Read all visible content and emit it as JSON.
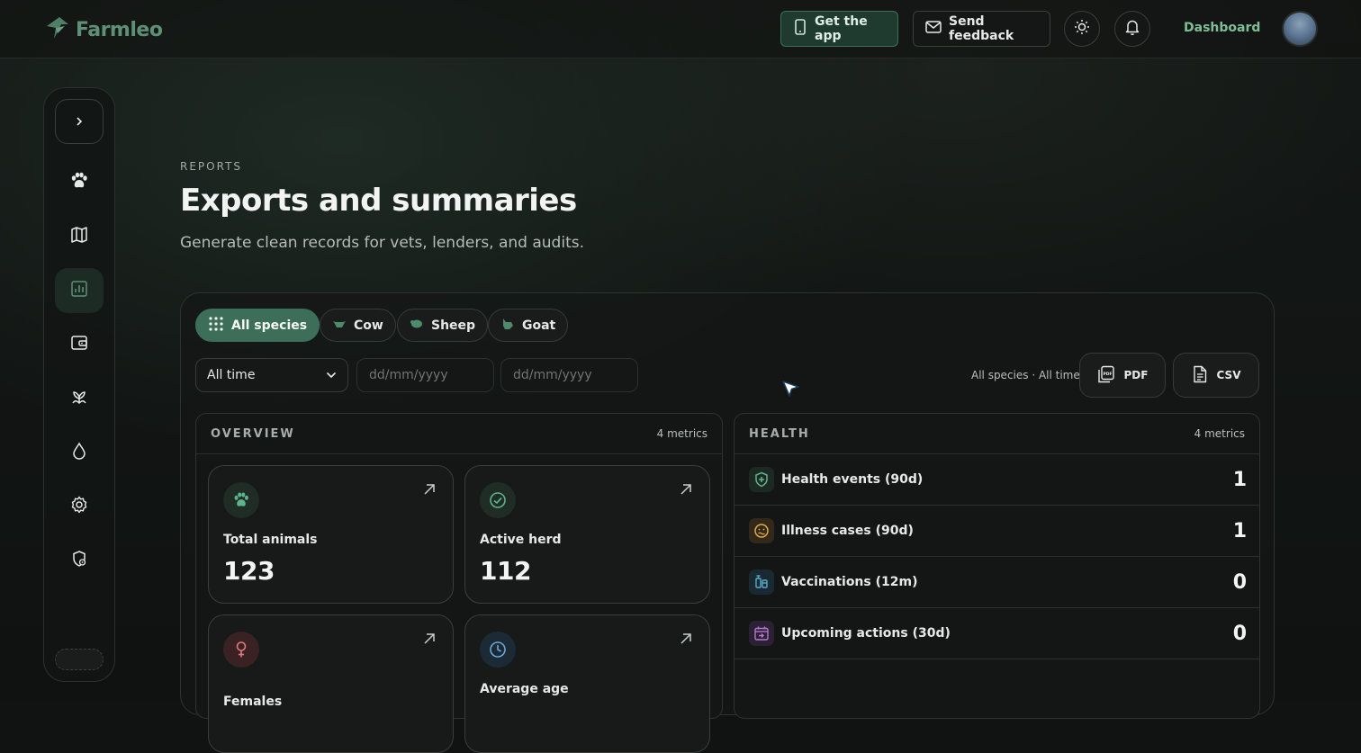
{
  "brand": {
    "name": "Farmleo",
    "accent": "#5f8f77"
  },
  "topbar": {
    "get_app": "Get the app",
    "send_feedback": "Send feedback",
    "dashboard": "Dashboard"
  },
  "sidebar": {
    "items": [
      {
        "icon": "paw-icon"
      },
      {
        "icon": "map-icon"
      },
      {
        "icon": "chart-icon",
        "active": true
      },
      {
        "icon": "wallet-icon"
      },
      {
        "icon": "plant-icon"
      },
      {
        "icon": "drop-icon"
      },
      {
        "icon": "gear-icon"
      },
      {
        "icon": "shield-icon"
      }
    ]
  },
  "header": {
    "eyebrow": "REPORTS",
    "title": "Exports and summaries",
    "subtitle": "Generate clean records for vets, lenders, and audits."
  },
  "filters": {
    "species": [
      "All species",
      "Cow",
      "Sheep",
      "Goat"
    ],
    "active_species": "All species",
    "period": "All time",
    "date_from_placeholder": "dd/mm/yyyy",
    "date_to_placeholder": "dd/mm/yyyy",
    "summary": "All species · All time"
  },
  "exports": {
    "pdf": "PDF",
    "csv": "CSV"
  },
  "overview": {
    "title": "OVERVIEW",
    "count": "4 metrics",
    "metrics": [
      {
        "label": "Total animals",
        "value": "123"
      },
      {
        "label": "Active herd",
        "value": "112"
      },
      {
        "label": "Females",
        "value": ""
      },
      {
        "label": "Average age",
        "value": ""
      }
    ]
  },
  "health": {
    "title": "HEALTH",
    "count": "4 metrics",
    "rows": [
      {
        "label": "Health events (90d)",
        "value": "1",
        "color": "#5fb38b"
      },
      {
        "label": "Illness cases (90d)",
        "value": "1",
        "color": "#e0a94a"
      },
      {
        "label": "Vaccinations (12m)",
        "value": "0",
        "color": "#5aa9c9"
      },
      {
        "label": "Upcoming actions (30d)",
        "value": "0",
        "color": "#b27ad0"
      }
    ]
  }
}
